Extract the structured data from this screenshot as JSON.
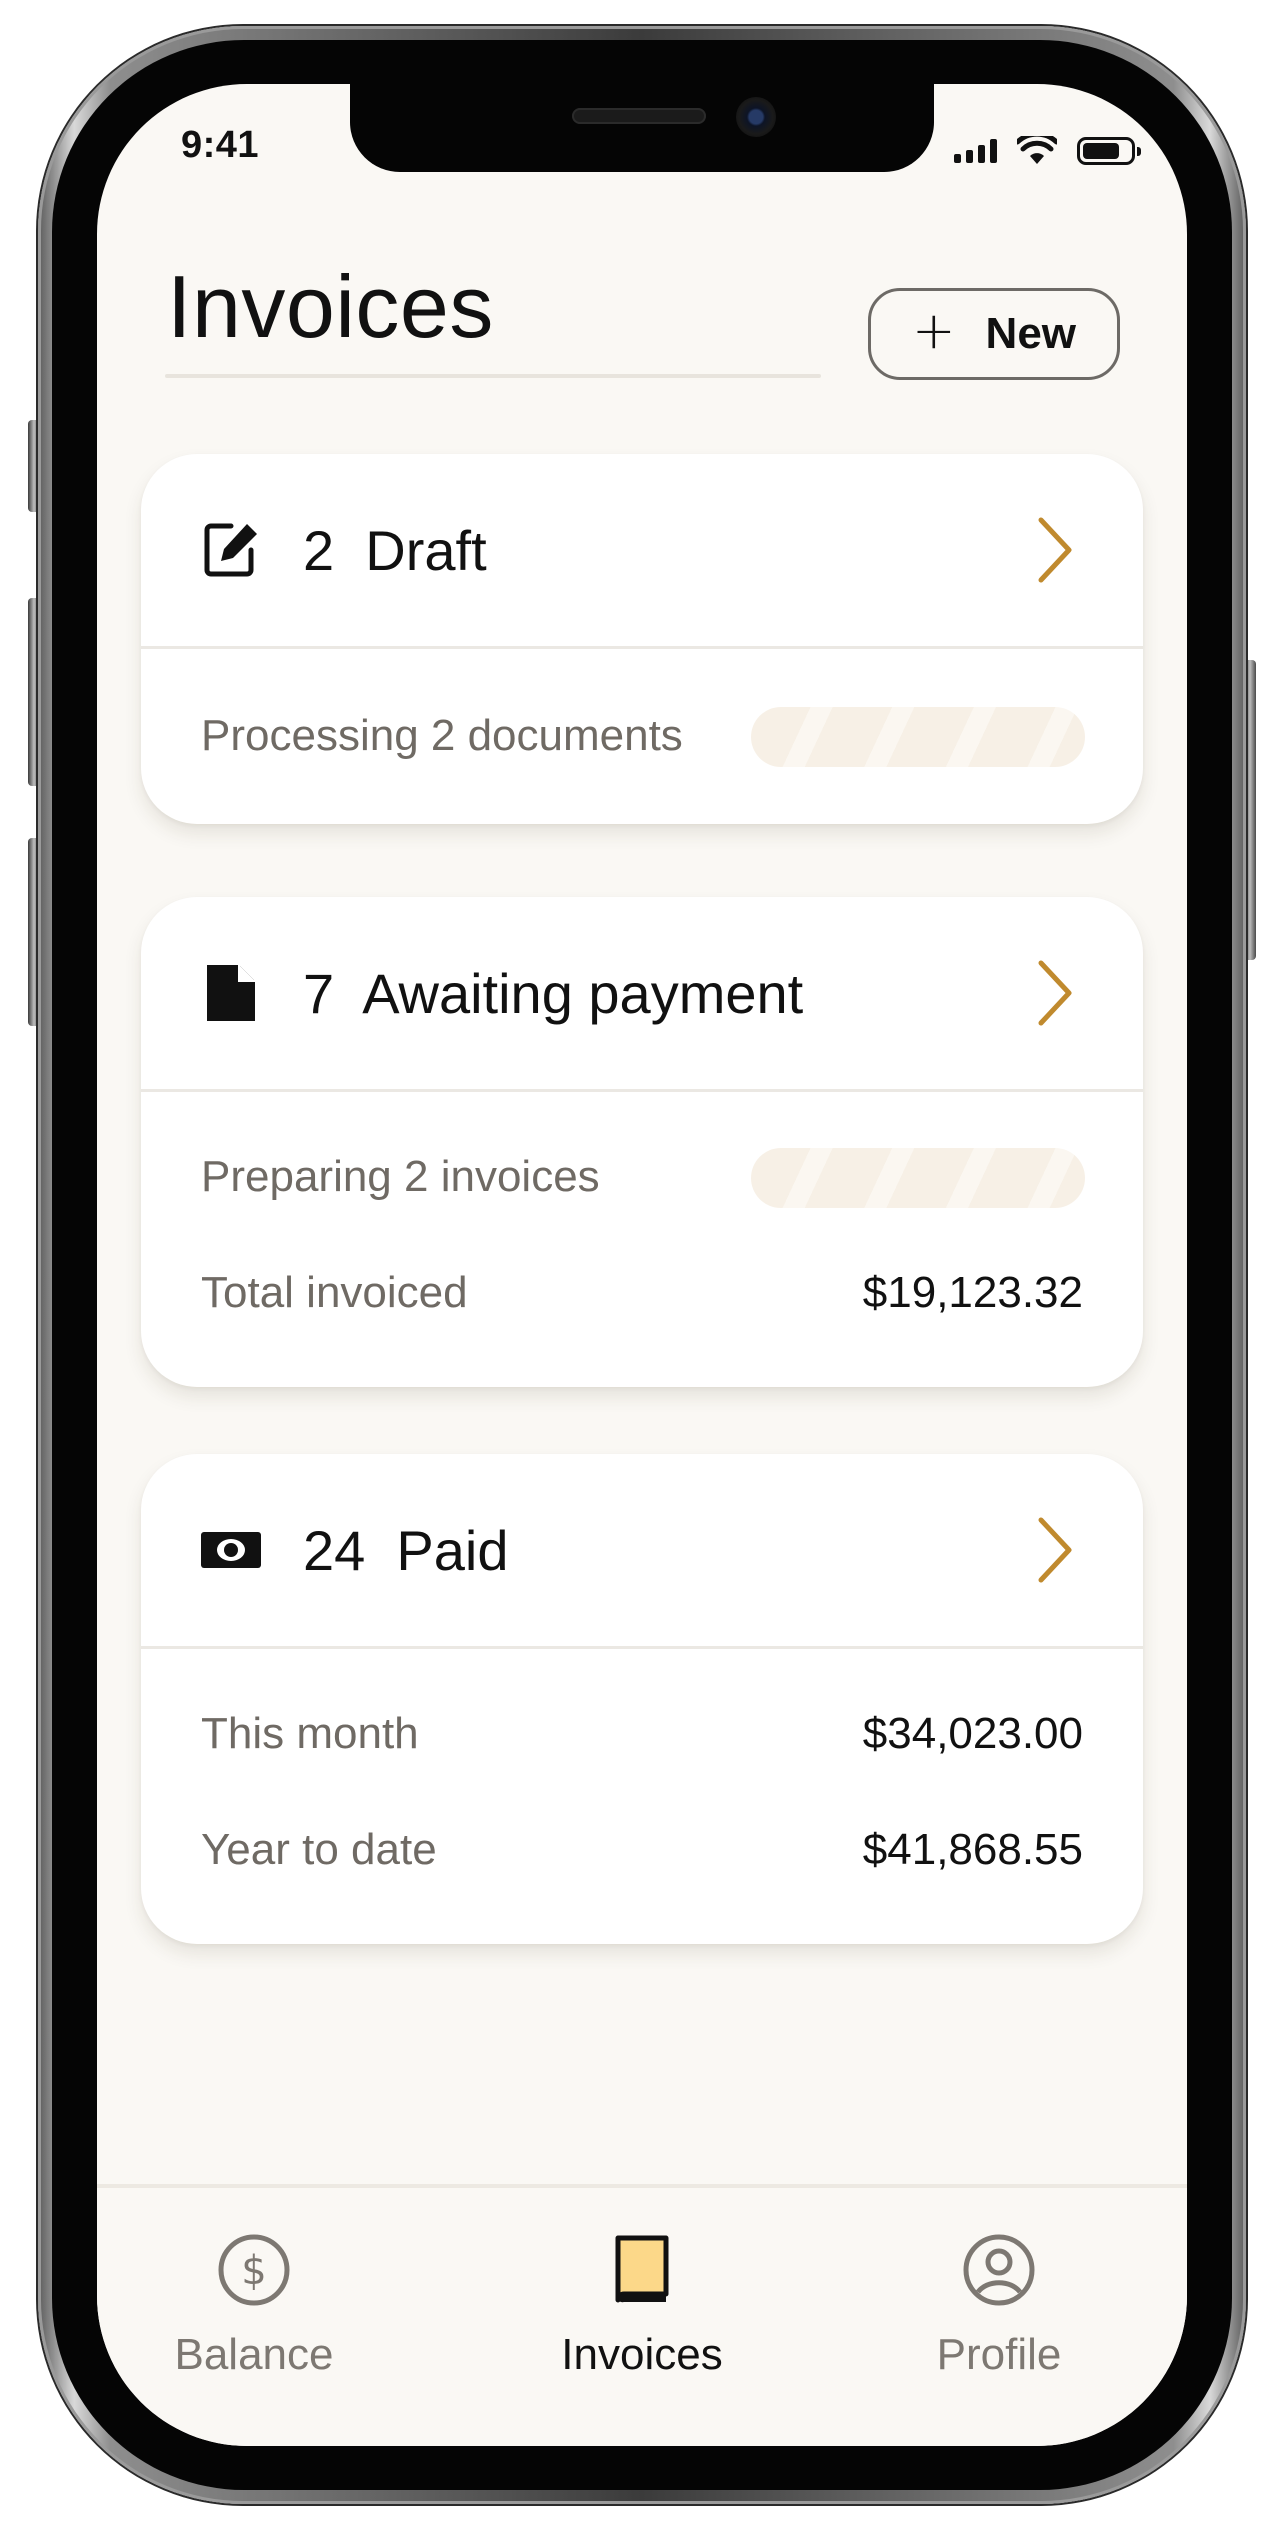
{
  "status_bar": {
    "time": "9:41"
  },
  "header": {
    "title": "Invoices",
    "new_button_label": "New"
  },
  "cards": {
    "draft": {
      "count": "2",
      "label": "Draft",
      "rows": [
        {
          "label": "Processing 2 documents"
        }
      ]
    },
    "awaiting": {
      "count": "7",
      "label": "Awaiting payment",
      "rows": [
        {
          "label": "Preparing 2 invoices"
        },
        {
          "label": "Total invoiced",
          "value": "$19,123.32"
        }
      ]
    },
    "paid": {
      "count": "24",
      "label": "Paid",
      "rows": [
        {
          "label": "This month",
          "value": "$34,023.00"
        },
        {
          "label": "Year to date",
          "value": "$41,868.55"
        }
      ]
    }
  },
  "tabbar": {
    "tabs": [
      {
        "label": "Balance",
        "icon": "dollar-circle-icon",
        "active": false
      },
      {
        "label": "Invoices",
        "icon": "book-icon",
        "active": true
      },
      {
        "label": "Profile",
        "icon": "user-circle-icon",
        "active": false
      }
    ]
  },
  "colors": {
    "accent": "#c08a2e",
    "background": "#faf8f4",
    "card": "#ffffff",
    "text_primary": "#111111",
    "text_secondary": "#6f6a64",
    "tab_inactive": "#7d7872",
    "skeleton": "#f7f0e6",
    "active_tab_icon_fill": "#fcd889"
  }
}
